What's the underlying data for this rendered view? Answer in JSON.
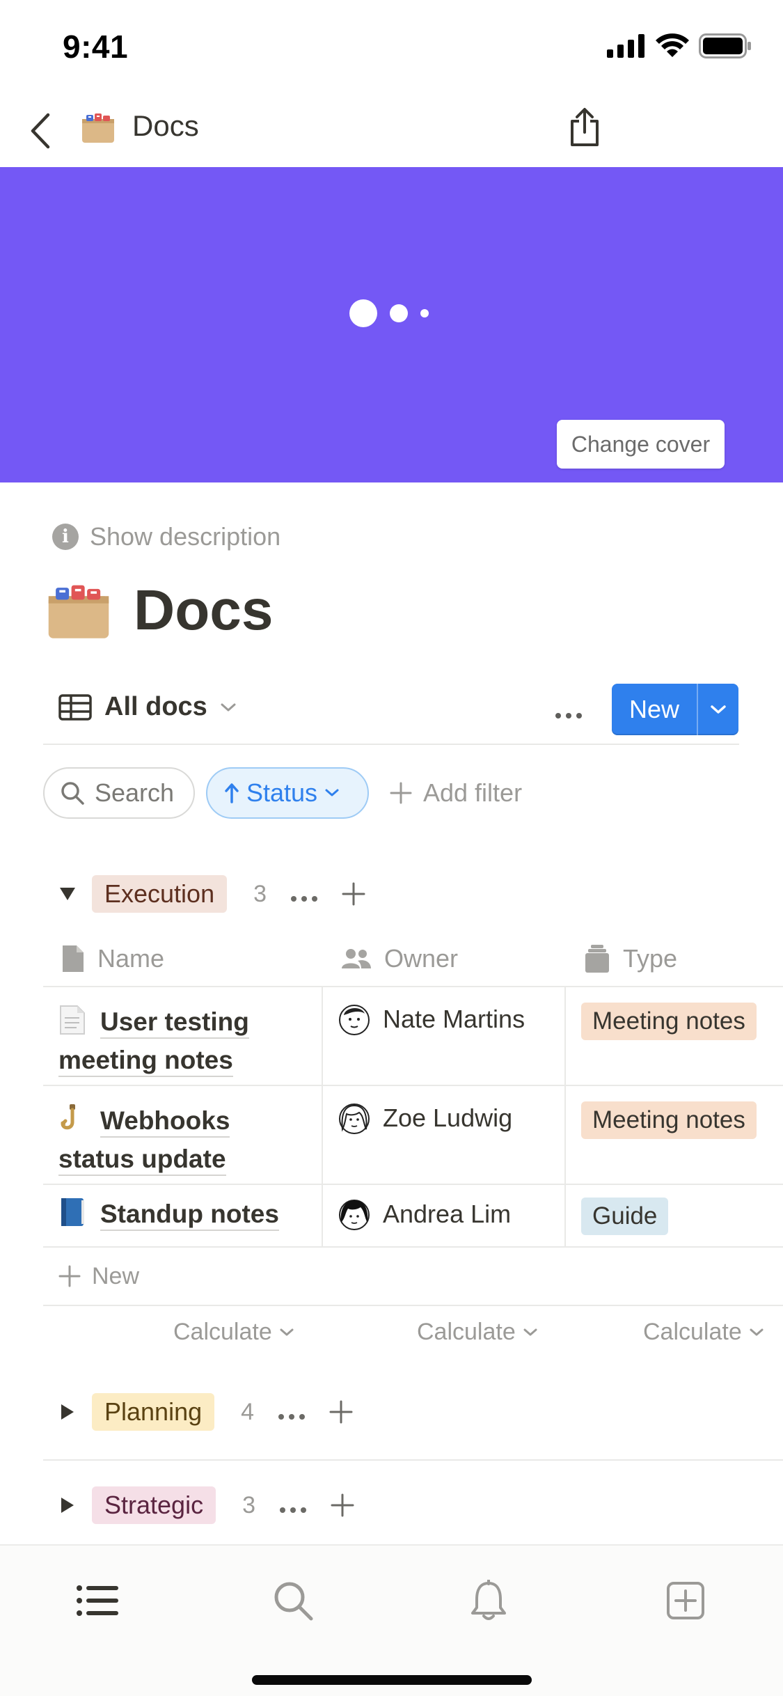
{
  "status_bar": {
    "time": "9:41"
  },
  "nav": {
    "title": "Docs",
    "page_icon": "file-cabinet-emoji"
  },
  "cover": {
    "color": "#7458f5",
    "change_cover_label": "Change cover"
  },
  "page": {
    "show_description_label": "Show description",
    "title": "Docs",
    "icon": "file-cabinet-emoji"
  },
  "view": {
    "current_view": "All docs",
    "new_label": "New",
    "accent_color": "#2f80ed"
  },
  "filters": {
    "search_label": "Search",
    "sort_label": "Status",
    "add_filter_label": "Add filter"
  },
  "groups": {
    "execution": {
      "label": "Execution",
      "count": "3",
      "color": "#f3e3dc"
    },
    "planning": {
      "label": "Planning",
      "count": "4",
      "color": "#fcecc4"
    },
    "strategic": {
      "label": "Strategic",
      "count": "3",
      "color": "#f5dfe7"
    }
  },
  "table": {
    "columns": {
      "name": "Name",
      "owner": "Owner",
      "type": "Type"
    },
    "rows": [
      {
        "title_line1": "User testing",
        "title_line2": "meeting notes",
        "emoji": "page-emoji",
        "owner": "Nate Martins",
        "type": "Meeting notes",
        "type_color": "#f8dfcc"
      },
      {
        "title_line1": "Webhooks",
        "title_line2": "status update",
        "emoji": "hook-emoji",
        "owner": "Zoe Ludwig",
        "type": "Meeting notes",
        "type_color": "#f8dfcc"
      },
      {
        "title_line1": "Standup notes",
        "title_line2": "",
        "emoji": "blue-book-emoji",
        "owner": "Andrea Lim",
        "type": "Guide",
        "type_color": "#d8e8f0"
      }
    ],
    "new_row_label": "New",
    "calculate_label": "Calculate"
  }
}
